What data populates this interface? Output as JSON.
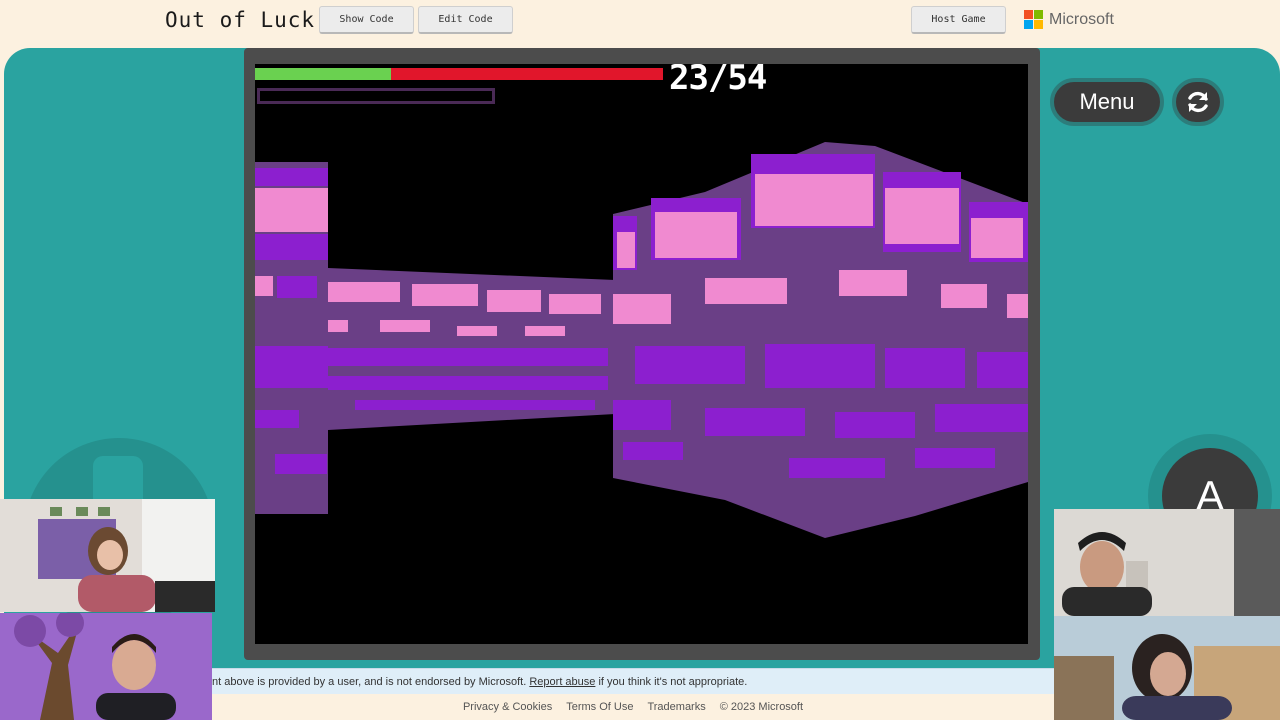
{
  "header": {
    "title": "Out of Luck",
    "show_code": "Show Code",
    "edit_code": "Edit Code",
    "host_game": "Host Game",
    "brand": "Microsoft"
  },
  "game": {
    "hp_current": 23,
    "hp_max": 54,
    "hp_text": "23/54",
    "hp_fraction": 0.333
  },
  "controls": {
    "menu_label": "Menu",
    "a_label": "A",
    "refresh_icon": "refresh-icon"
  },
  "disclaimer": {
    "text_before": "nt above is provided by a user, and is not endorsed by Microsoft.",
    "link": "Report abuse",
    "text_after": "if you think it's not appropriate."
  },
  "footer": {
    "links": [
      "Privacy & Cookies",
      "Terms Of Use",
      "Trademarks",
      "© 2023 Microsoft"
    ]
  },
  "colors": {
    "panel": "#2aa3a0",
    "hp_green": "#6ad150",
    "hp_red": "#e1162b",
    "brick_light": "#f08ad0",
    "brick_dark": "#8c1fcf",
    "mortar": "#6a3f86"
  }
}
